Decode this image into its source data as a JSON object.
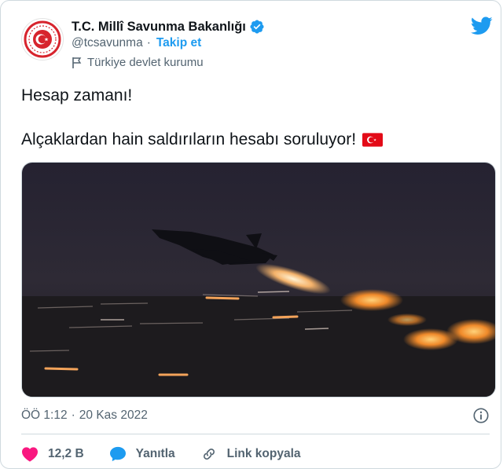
{
  "account": {
    "display_name": "T.C. Millî Savunma Bakanlığı",
    "handle": "@tcsavunma",
    "separator": "·",
    "follow_label": "Takip et",
    "affiliation_label": "Türkiye devlet kurumu"
  },
  "tweet": {
    "line1": "Hesap zamanı!",
    "line2": "Alçaklardan hain saldırıların hesabı soruluyor!"
  },
  "meta": {
    "time": "ÖÖ 1:12",
    "separator": "·",
    "date": "20 Kas 2022"
  },
  "actions": {
    "like_count": "12,2 B",
    "reply_label": "Yanıtla",
    "copy_link_label": "Link kopyala"
  },
  "colors": {
    "accent": "#1d9bf0",
    "like": "#f91880",
    "text": "#0f1419",
    "muted": "#536471",
    "flag_red": "#e30a17"
  },
  "icons": [
    "verified-badge-icon",
    "twitter-bird-icon",
    "flag-icon",
    "turkish-flag-icon",
    "info-icon",
    "heart-icon",
    "reply-icon",
    "link-icon"
  ]
}
